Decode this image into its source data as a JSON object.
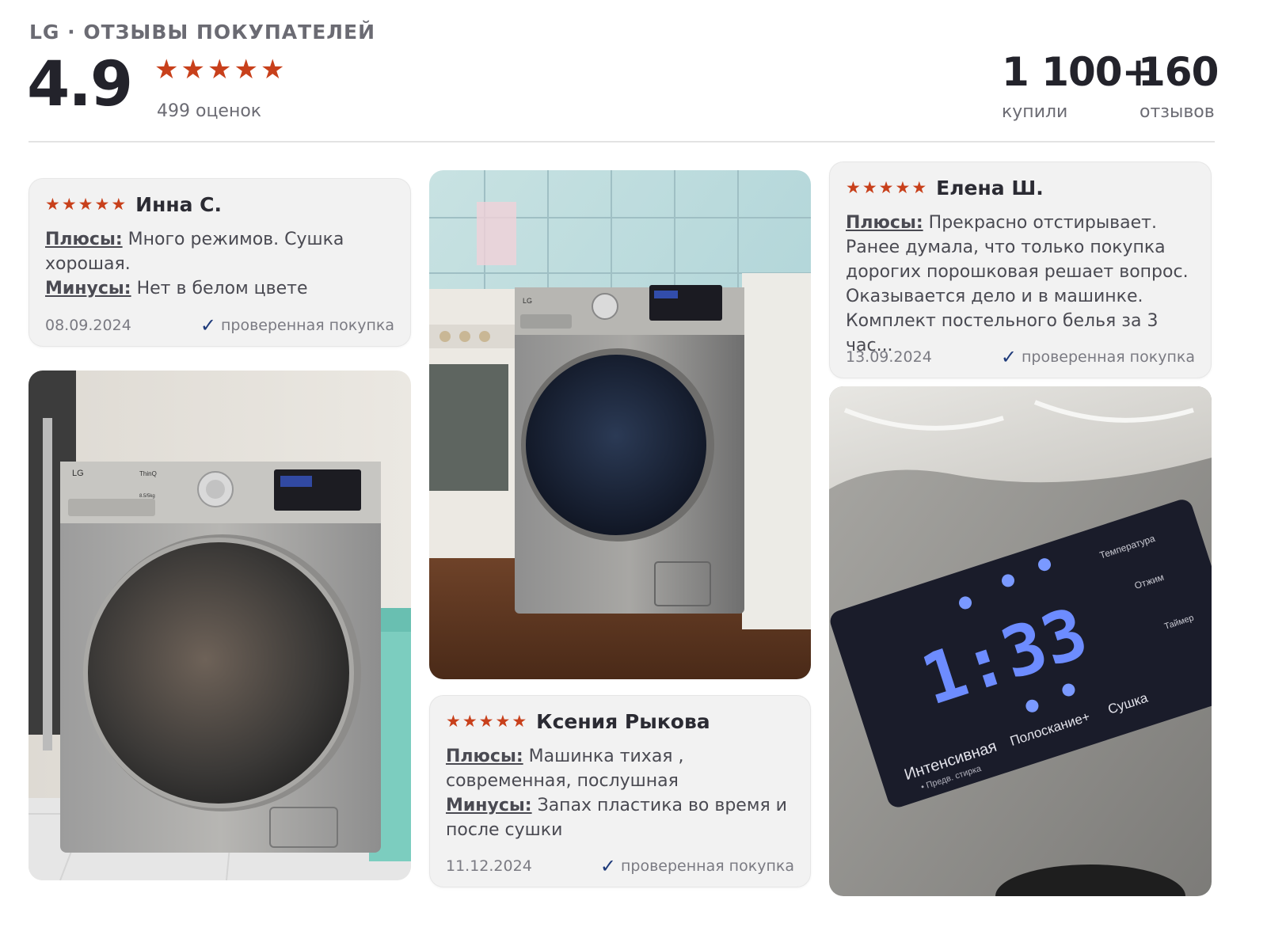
{
  "header": {
    "brand": "LG · ОТЗЫВЫ ПОКУПАТЕЛЕЙ",
    "rating": "4.9",
    "rating_stars": 5,
    "rating_count": "499 оценок",
    "buyers_num": "1 100+",
    "buyers_label": "купили",
    "reviews_num": "160",
    "reviews_label": "отзывов"
  },
  "colors": {
    "star": "#c8401b",
    "check": "#1e3a7a",
    "card_bg": "#f2f2f2"
  },
  "reviews": [
    {
      "author": "Инна С.",
      "stars": 5,
      "pros_label": "Плюсы:",
      "pros": "Много режимов. Сушка хорошая.",
      "cons_label": "Минусы:",
      "cons": "Нет в белом цвете",
      "date": "08.09.2024",
      "verified": "проверенная покупка"
    },
    {
      "author": "Ксения Рыкова",
      "stars": 5,
      "pros_label": "Плюсы:",
      "pros": "Машинка тихая , современная, послушная",
      "cons_label": "Минусы:",
      "cons": "Запах пластика во время и после сушки",
      "date": "11.12.2024",
      "verified": "проверенная покупка"
    },
    {
      "author": "Елена Ш.",
      "stars": 5,
      "pros_label": "Плюсы:",
      "pros": "Прекрасно отстирывает. Ранее думала, что только покупка дорогих порошковая решает вопрос. Оказывается дело и в машинке. Комплект постельного белья за 3 час...",
      "date": "13.09.2024",
      "verified": "проверенная покупка"
    }
  ],
  "photos": {
    "photo1": {
      "brand": "LG",
      "model": "ThinQ",
      "capacity": "8.5/5kg"
    },
    "photo2": {
      "brand": "LG"
    },
    "photo3": {
      "display": "1:33",
      "mode1": "Интенсивная",
      "mode1_sub": "• Предв. стирка",
      "mode2": "Полоскание+",
      "mode3": "Сушка",
      "temp": "Температура",
      "spin": "Отжим",
      "timer": "Таймер"
    }
  }
}
